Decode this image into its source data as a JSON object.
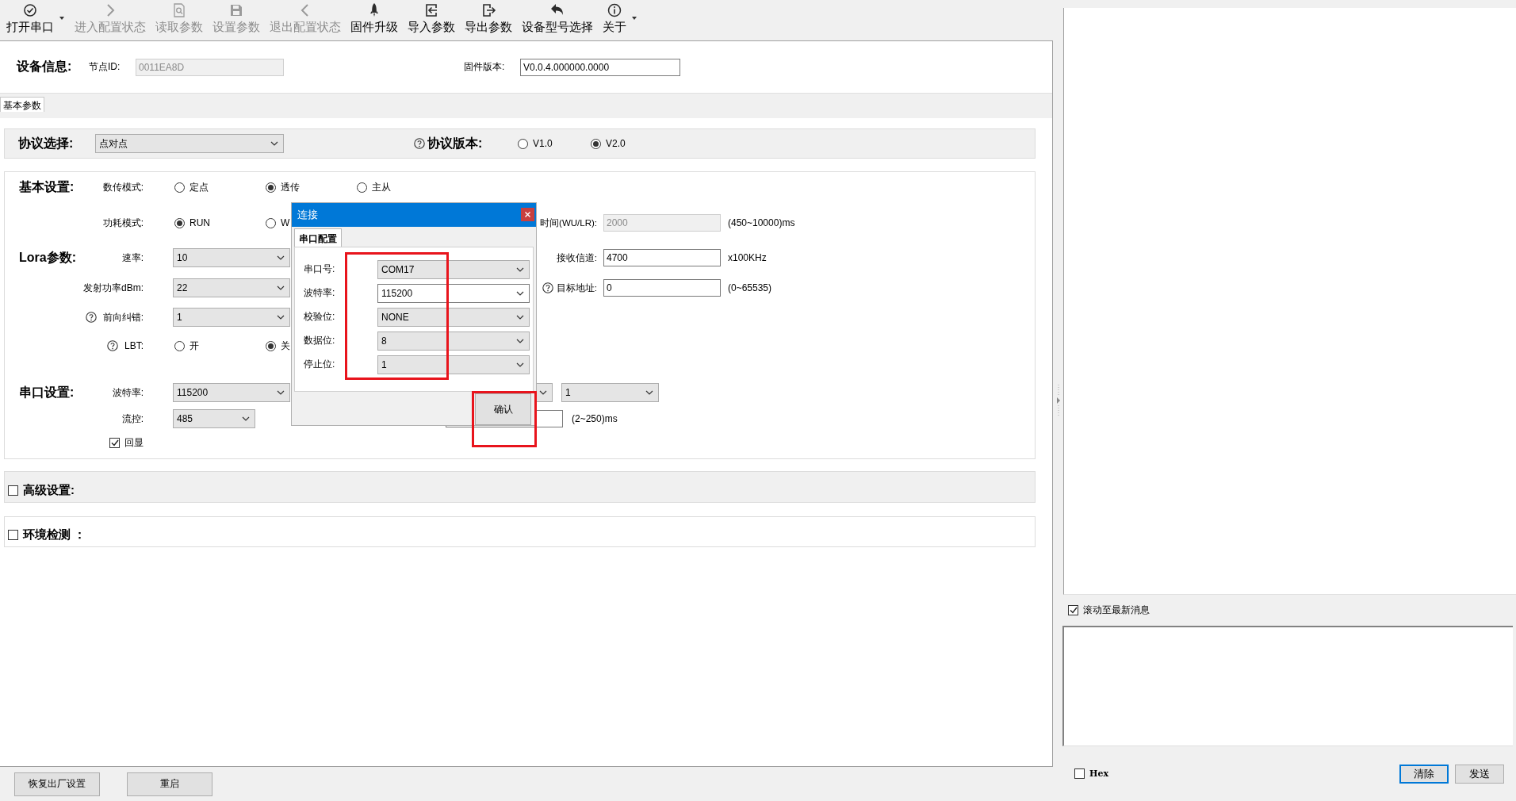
{
  "toolbar": {
    "items": [
      {
        "label": "打开串口",
        "disabled": false,
        "has_menu": true
      },
      {
        "label": "进入配置状态",
        "disabled": true
      },
      {
        "label": "读取参数",
        "disabled": true
      },
      {
        "label": "设置参数",
        "disabled": true
      },
      {
        "label": "退出配置状态",
        "disabled": true
      },
      {
        "label": "固件升级",
        "disabled": false
      },
      {
        "label": "导入参数",
        "disabled": false
      },
      {
        "label": "导出参数",
        "disabled": false
      },
      {
        "label": "设备型号选择",
        "disabled": false
      },
      {
        "label": "关于",
        "disabled": false,
        "has_menu": true
      }
    ]
  },
  "device_info": {
    "title": "设备信息:",
    "fields": [
      {
        "label": "节点ID:",
        "value": "0011EA8D",
        "disabled": true
      },
      {
        "label": "固件版本:",
        "value": "V0.0.4.000000.0000",
        "disabled": false
      }
    ]
  },
  "tabs": [
    {
      "label": "基本参数",
      "selected": true
    }
  ],
  "protocol": {
    "title": "协议选择:",
    "value": "点对点",
    "version_label": "协议版本:",
    "versions": [
      {
        "label": "V1.0",
        "selected": false
      },
      {
        "label": "V2.0",
        "selected": true
      }
    ]
  },
  "settings": {
    "sections": [
      {
        "title": "基本设置:",
        "rows": [
          {
            "label": "数传模式:",
            "control": {
              "kind": "radio",
              "options": [
                {
                  "label": "定点",
                  "selected": false
                },
                {
                  "label": "透传",
                  "selected": true
                },
                {
                  "label": "主从",
                  "selected": false
                }
              ]
            }
          },
          {
            "label": "功耗模式:",
            "control": {
              "kind": "radio",
              "options": [
                {
                  "label": "RUN",
                  "selected": true
                },
                {
                  "label": "W",
                  "selected": false
                }
              ]
            },
            "right": {
              "kind": "field",
              "label": "时间(WU/LR):",
              "value": "2000",
              "disabled": true,
              "unit": "(450~10000)ms"
            }
          }
        ]
      },
      {
        "title": "Lora参数:",
        "rows": [
          {
            "label": "速率:",
            "control": {
              "kind": "select",
              "value": "10"
            },
            "right": {
              "kind": "field",
              "label": "接收信道:",
              "value": "4700",
              "disabled": false,
              "unit": "x100KHz"
            }
          },
          {
            "label": "发射功率dBm:",
            "control": {
              "kind": "select",
              "value": "22"
            },
            "right": {
              "kind": "field",
              "label": "目标地址:",
              "help": true,
              "value": "0",
              "disabled": false,
              "unit": "(0~65535)"
            }
          },
          {
            "label": "前向纠错:",
            "help": true,
            "control": {
              "kind": "select",
              "value": "1"
            }
          },
          {
            "label": "LBT:",
            "help": true,
            "control": {
              "kind": "radio",
              "options": [
                {
                  "label": "开",
                  "selected": false
                },
                {
                  "label": "关",
                  "selected": true
                }
              ]
            }
          }
        ]
      },
      {
        "title": "串口设置:",
        "rows": [
          {
            "label": "波特率:",
            "control": {
              "kind": "select",
              "value": "115200"
            },
            "right": {
              "kind": "select",
              "value": "1"
            }
          },
          {
            "label": "流控:",
            "control": {
              "kind": "select",
              "value": "485"
            },
            "right": {
              "kind": "bare_field",
              "unit": "(2~250)ms"
            }
          },
          {
            "control": {
              "kind": "checkbox",
              "label": "回显",
              "checked": true
            }
          }
        ]
      }
    ]
  },
  "collapsibles": [
    {
      "label": "高级设置:",
      "checked": false
    },
    {
      "label": "环境检测 ：",
      "checked": false
    }
  ],
  "footer_buttons": [
    "恢复出厂设置",
    "重启"
  ],
  "log_panel": {
    "autoscroll": {
      "label": "滚动至最新消息",
      "checked": true
    },
    "hex": {
      "label": "Hex",
      "checked": false
    },
    "buttons": [
      {
        "label": "清除",
        "focused": true
      },
      {
        "label": "发送",
        "focused": false
      }
    ]
  },
  "dialog": {
    "title": "连接",
    "tabs": [
      {
        "label": "串口配置",
        "selected": true
      }
    ],
    "fields": [
      {
        "label": "串口号:",
        "value": "COM17",
        "editable": false
      },
      {
        "label": "波特率:",
        "value": "115200",
        "editable": true
      },
      {
        "label": "校验位:",
        "value": "NONE",
        "editable": false
      },
      {
        "label": "数据位:",
        "value": "8",
        "editable": false
      },
      {
        "label": "停止位:",
        "value": "1",
        "editable": false
      }
    ],
    "confirm": "确认"
  }
}
